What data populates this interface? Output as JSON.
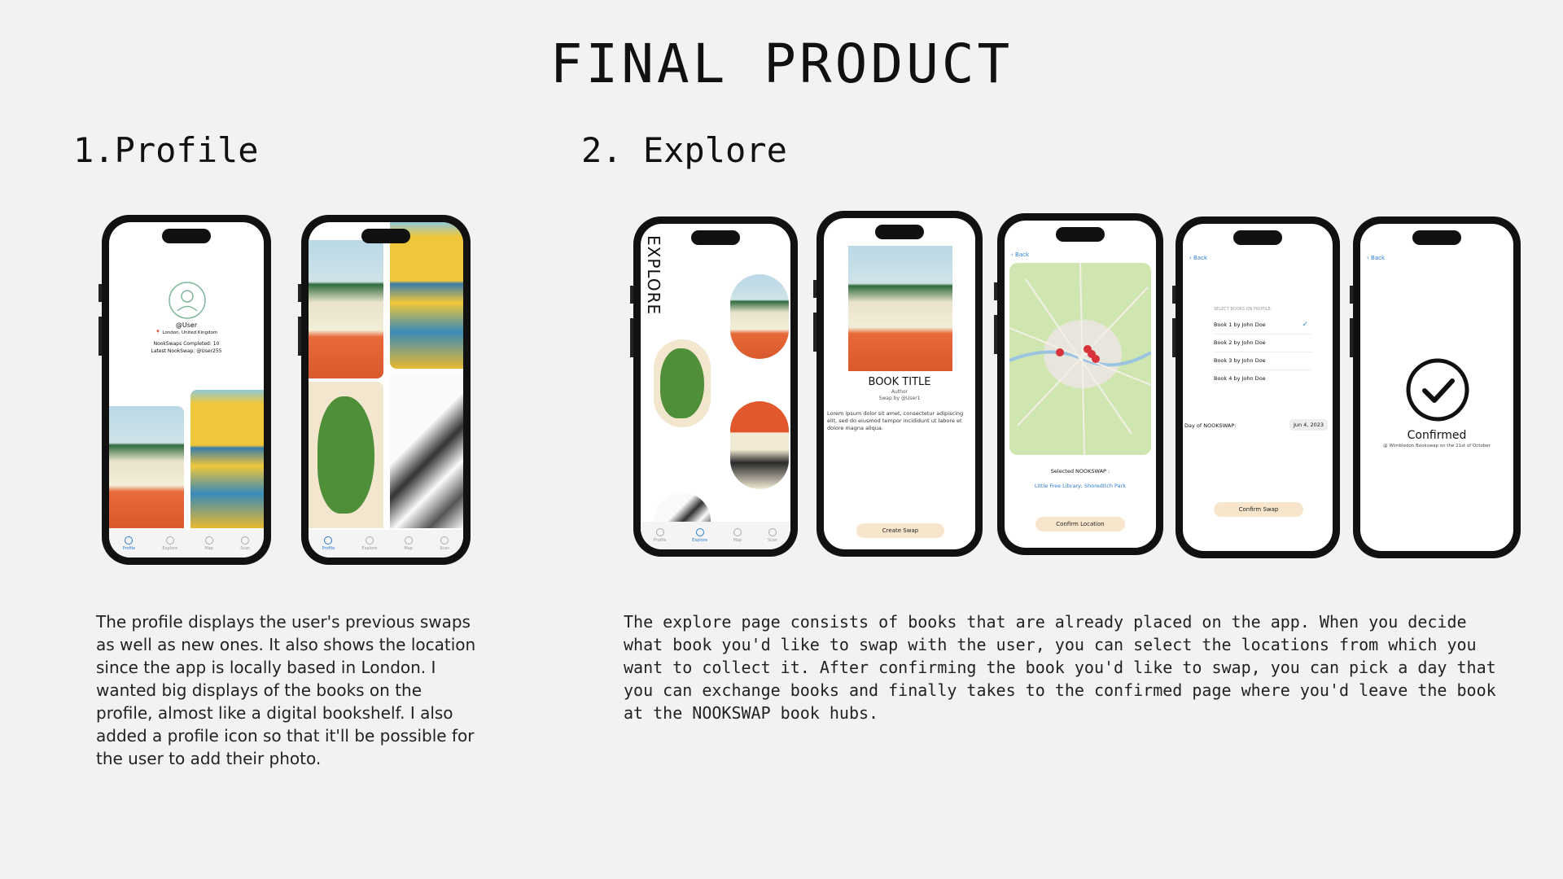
{
  "title": "FINAL PRODUCT",
  "sections": {
    "profile": "1.Profile",
    "explore": "2. Explore"
  },
  "profile_screen": {
    "username": "@User",
    "location": "📍 London, United Kingdom",
    "swaps_completed": "NookSwaps Completed: 10",
    "latest_swap": "Latest NookSwap: @User255"
  },
  "tabs": [
    "Profile",
    "Explore",
    "Map",
    "Scan"
  ],
  "explore_screen": {
    "vertical_label": "EXPLORE"
  },
  "book_screen": {
    "book_title": "BOOK TITLE",
    "author": "Author",
    "swap_by": "Swap by @User1",
    "lorem": "Lorem ipsum dolor sit amet, consectetur adipiscing elit, sed do eiusmod tempor incididunt ut labore et dolore magna aliqua.",
    "create_swap": "Create Swap"
  },
  "map_screen": {
    "back": "Back",
    "selected_label": "Selected NOOKSWAP :",
    "selected_location": "Little Free Library, Shoreditch Park",
    "confirm_location": "Confirm Location"
  },
  "select_screen": {
    "back": "Back",
    "heading": "SELECT BOOKS ON PROFILE:",
    "books": [
      "Book 1 by John Doe",
      "Book 2 by John Doe",
      "Book 3 by John Doe",
      "Book 4 by John Doe"
    ],
    "day_label": "Day of NOOKSWAP:",
    "day_value": "Jun 4, 2023",
    "confirm_swap": "Confirm Swap"
  },
  "confirmed_screen": {
    "back": "Back",
    "confirmed": "Confirmed",
    "detail": "@ Wimbledon Bookswap on the 21st of October"
  },
  "descriptions": {
    "profile": "The profile displays the user's previous swaps as well as new ones. It also shows the location since the app is locally based in London. I wanted big displays of the books on the profile, almost like a digital bookshelf. I also added a profile icon so that it'll be possible for the user to add their photo.",
    "explore": "The explore page consists of books that are already placed on the app. When you decide what book you'd like to swap with the user, you can select the locations from which you want to collect it. After confirming the book you'd like to swap, you can pick a day that you can exchange books and finally takes to the confirmed page where you'd leave the book at the NOOKSWAP book hubs."
  },
  "colors": {
    "background": "#f2f2f1",
    "accent": "#2a7bd6",
    "button": "#f8e6cc",
    "pin": "#d6333a"
  }
}
